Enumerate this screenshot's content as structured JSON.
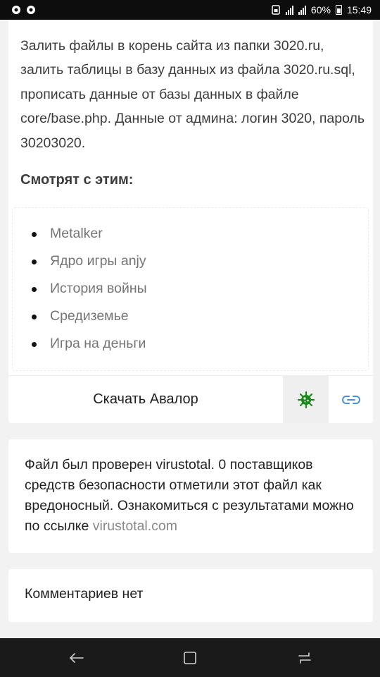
{
  "status_bar": {
    "battery_text": "60%",
    "time": "15:49"
  },
  "main": {
    "description": "Залить файлы в корень сайта из папки 3020.ru, залить таблицы в базу данных из файла 3020.ru.sql, прописать данные от базы данных в файле core/base.php. Данные от админа: логин 3020, пароль 30203020.",
    "see_also_heading": "Смотрят с этим:",
    "related": [
      {
        "label": "Metalker"
      },
      {
        "label": "Ядро игры anjy"
      },
      {
        "label": "История войны"
      },
      {
        "label": "Средиземье"
      },
      {
        "label": "Игра на деньги"
      }
    ],
    "download_label": "Скачать Авалор"
  },
  "virustotal": {
    "text": "Файл был проверен virustotal. 0 поставщиков средств безопасности отметили этот файл как вредоносный. Ознакомиться с результатами можно по ссылке ",
    "link_text": "virustotal.com"
  },
  "comments": {
    "empty_text": "Комментариев нет"
  },
  "colors": {
    "virus_icon": "#1a8a1a",
    "link_icon": "#4a90d9"
  }
}
